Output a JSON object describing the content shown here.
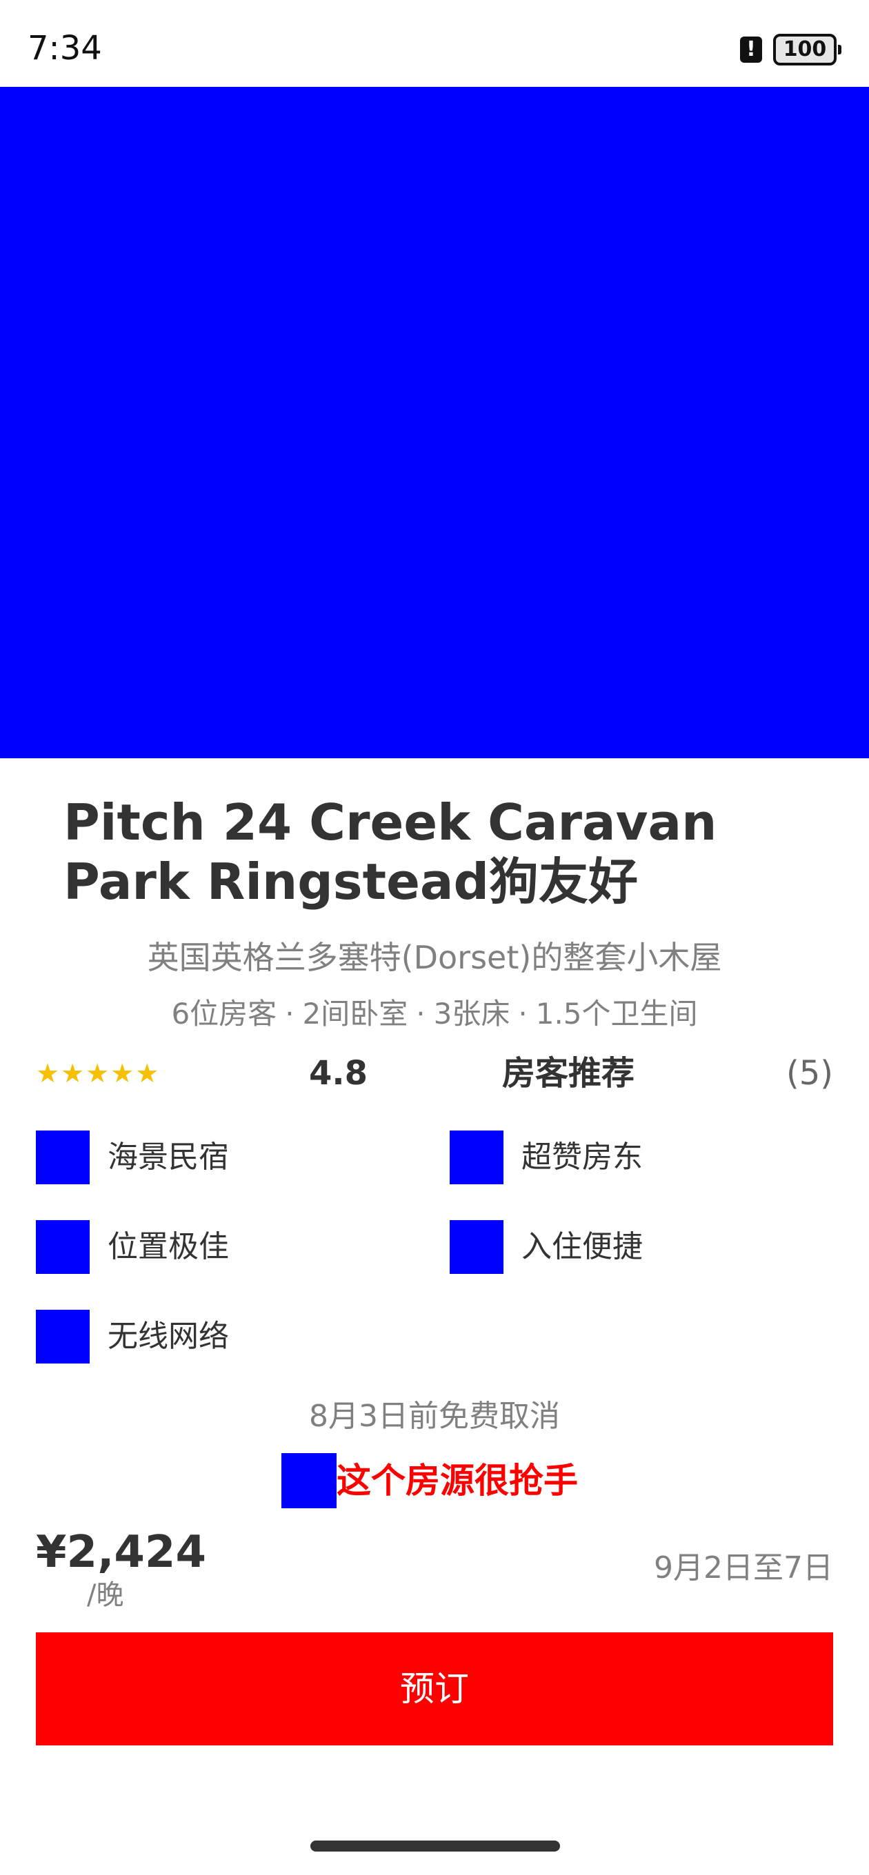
{
  "status_bar": {
    "time": "7:34",
    "alert_glyph": "!",
    "battery_level": "100"
  },
  "listing": {
    "title": "Pitch 24 Creek Caravan Park Ringstead狗友好",
    "subtitle": "英国英格兰多塞特(Dorset)的整套小木屋",
    "specs": {
      "guests": "6位房客",
      "bedrooms": "2间卧室",
      "beds": "3张床",
      "baths": "1.5个卫生间",
      "separator": "·"
    },
    "rating": {
      "stars": "★★★★★",
      "value": "4.8",
      "guest_favorite": "房客推荐",
      "review_count": "(5)"
    },
    "amenities": [
      {
        "label": "海景民宿",
        "icon": "ocean-view-icon"
      },
      {
        "label": "超赞房东",
        "icon": "superhost-icon"
      },
      {
        "label": "位置极佳",
        "icon": "location-icon"
      },
      {
        "label": "入住便捷",
        "icon": "self-checkin-icon"
      },
      {
        "label": "无线网络",
        "icon": "wifi-icon"
      }
    ],
    "cancellation": "8月3日前免费取消",
    "hot_label": "这个房源很抢手"
  },
  "booking": {
    "price": "¥2,424",
    "per_night": "/晚",
    "dates": "9月2日至7日",
    "button_label": "预订"
  },
  "colors": {
    "accent": "#ff0000",
    "placeholder_image": "#0000ff",
    "star": "#f6c000"
  }
}
